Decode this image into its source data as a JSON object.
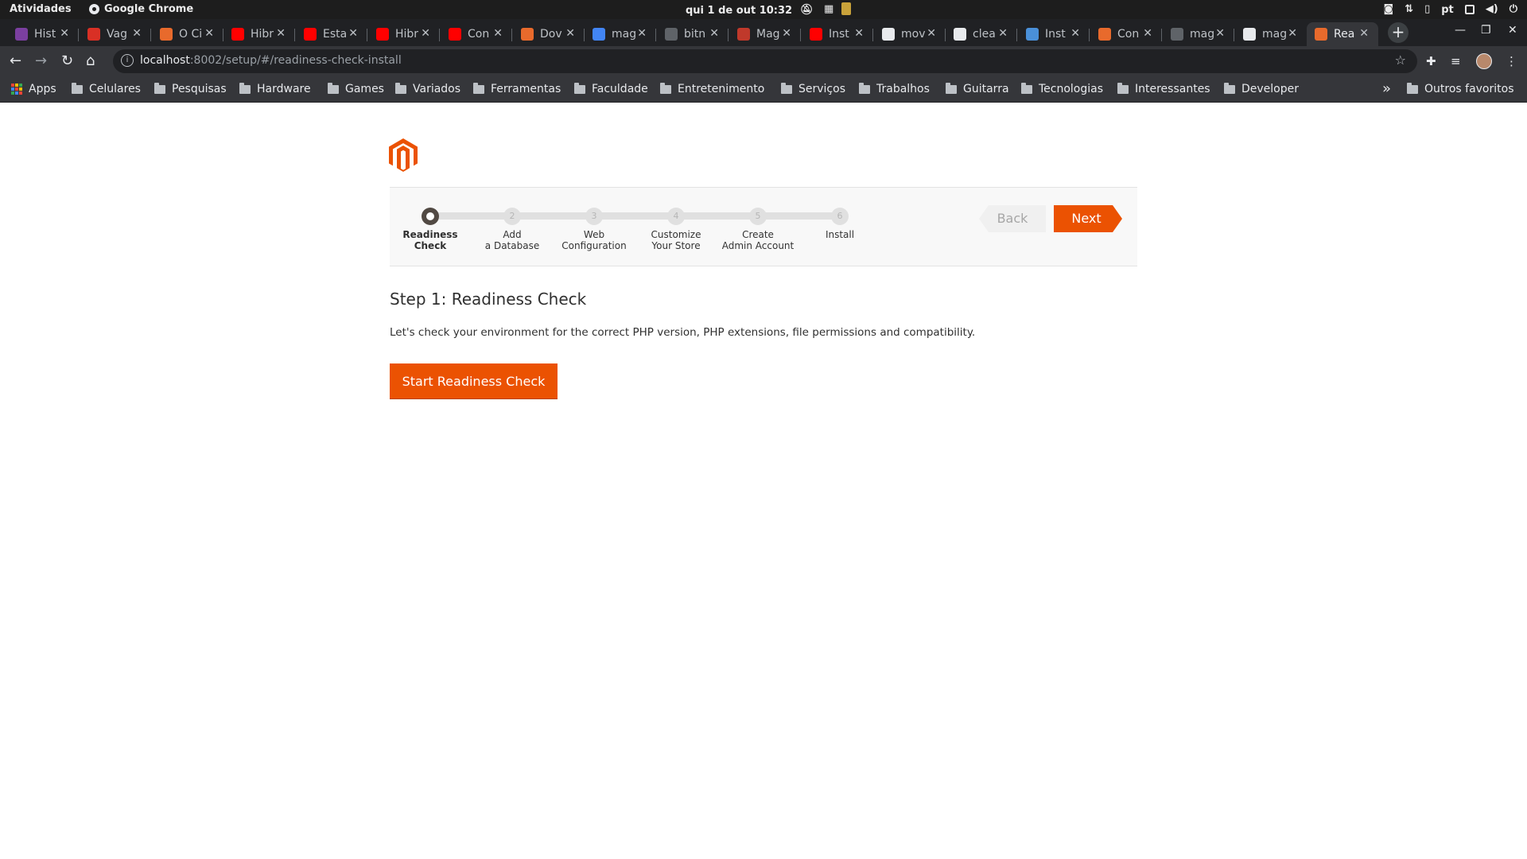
{
  "system_bar": {
    "activities": "Atividades",
    "app_name": "Google Chrome",
    "datetime": "qui 1 de out  10:32",
    "language": "pt"
  },
  "browser": {
    "tabs": [
      {
        "title": "Hist",
        "icon": "imdb-like-purple-icon",
        "color": "#7b3fa0"
      },
      {
        "title": "Vag",
        "icon": "gmail-icon",
        "color": "#d93025"
      },
      {
        "title": "O Ci",
        "icon": "linkedin-icon",
        "color": "#e86a2c"
      },
      {
        "title": "Hibr",
        "icon": "youtube-icon",
        "color": "#ff0000"
      },
      {
        "title": "Esta",
        "icon": "youtube-icon",
        "color": "#ff0000"
      },
      {
        "title": "Hibr",
        "icon": "youtube-icon",
        "color": "#ff0000"
      },
      {
        "title": "Con",
        "icon": "youtube-icon",
        "color": "#ff0000"
      },
      {
        "title": "Dov",
        "icon": "magento-icon",
        "color": "#e86a2c"
      },
      {
        "title": "mag",
        "icon": "google-icon",
        "color": "#4285f4"
      },
      {
        "title": "bitn",
        "icon": "globe-icon",
        "color": "#5f6368"
      },
      {
        "title": "Mag",
        "icon": "magento-red-icon",
        "color": "#c0392b"
      },
      {
        "title": "Inst",
        "icon": "youtube-icon",
        "color": "#ff0000"
      },
      {
        "title": "mov",
        "icon": "github-icon",
        "color": "#e8eaed"
      },
      {
        "title": "clea",
        "icon": "github-icon",
        "color": "#e8eaed"
      },
      {
        "title": "Inst",
        "icon": "globe-icon",
        "color": "#4a90d9"
      },
      {
        "title": "Con",
        "icon": "magento-icon",
        "color": "#e86a2c"
      },
      {
        "title": "mag",
        "icon": "globe-icon",
        "color": "#5f6368"
      },
      {
        "title": "mag",
        "icon": "github-icon",
        "color": "#e8eaed"
      },
      {
        "title": "Rea",
        "icon": "magento-icon",
        "color": "#e86a2c",
        "active": true
      }
    ],
    "url_host": "localhost",
    "url_path": ":8002/setup/#/readiness-check-install",
    "bookmarks": {
      "apps": "Apps",
      "folders": [
        "Celulares",
        "Pesquisas",
        "Hardware",
        "Games",
        "Variados",
        "Ferramentas",
        "Faculdade",
        "Entretenimento",
        "Serviços",
        "Trabalhos",
        "Guitarra",
        "Tecnologias",
        "Interessantes",
        "Developer"
      ],
      "overflow": "»",
      "other": "Outros favoritos"
    }
  },
  "wizard": {
    "steps": [
      {
        "num": "",
        "label_line1": "Readiness",
        "label_line2": "Check",
        "current": true
      },
      {
        "num": "2",
        "label_line1": "Add",
        "label_line2": "a Database"
      },
      {
        "num": "3",
        "label_line1": "Web",
        "label_line2": "Configuration"
      },
      {
        "num": "4",
        "label_line1": "Customize",
        "label_line2": "Your Store"
      },
      {
        "num": "5",
        "label_line1": "Create",
        "label_line2": "Admin Account"
      },
      {
        "num": "6",
        "label_line1": "Install",
        "label_line2": ""
      }
    ],
    "back_label": "Back",
    "next_label": "Next",
    "title": "Step 1: Readiness Check",
    "description": "Let's check your environment for the correct PHP version, PHP extensions, file permissions and compatibility.",
    "start_button": "Start Readiness Check",
    "accent_color": "#eb5202"
  }
}
